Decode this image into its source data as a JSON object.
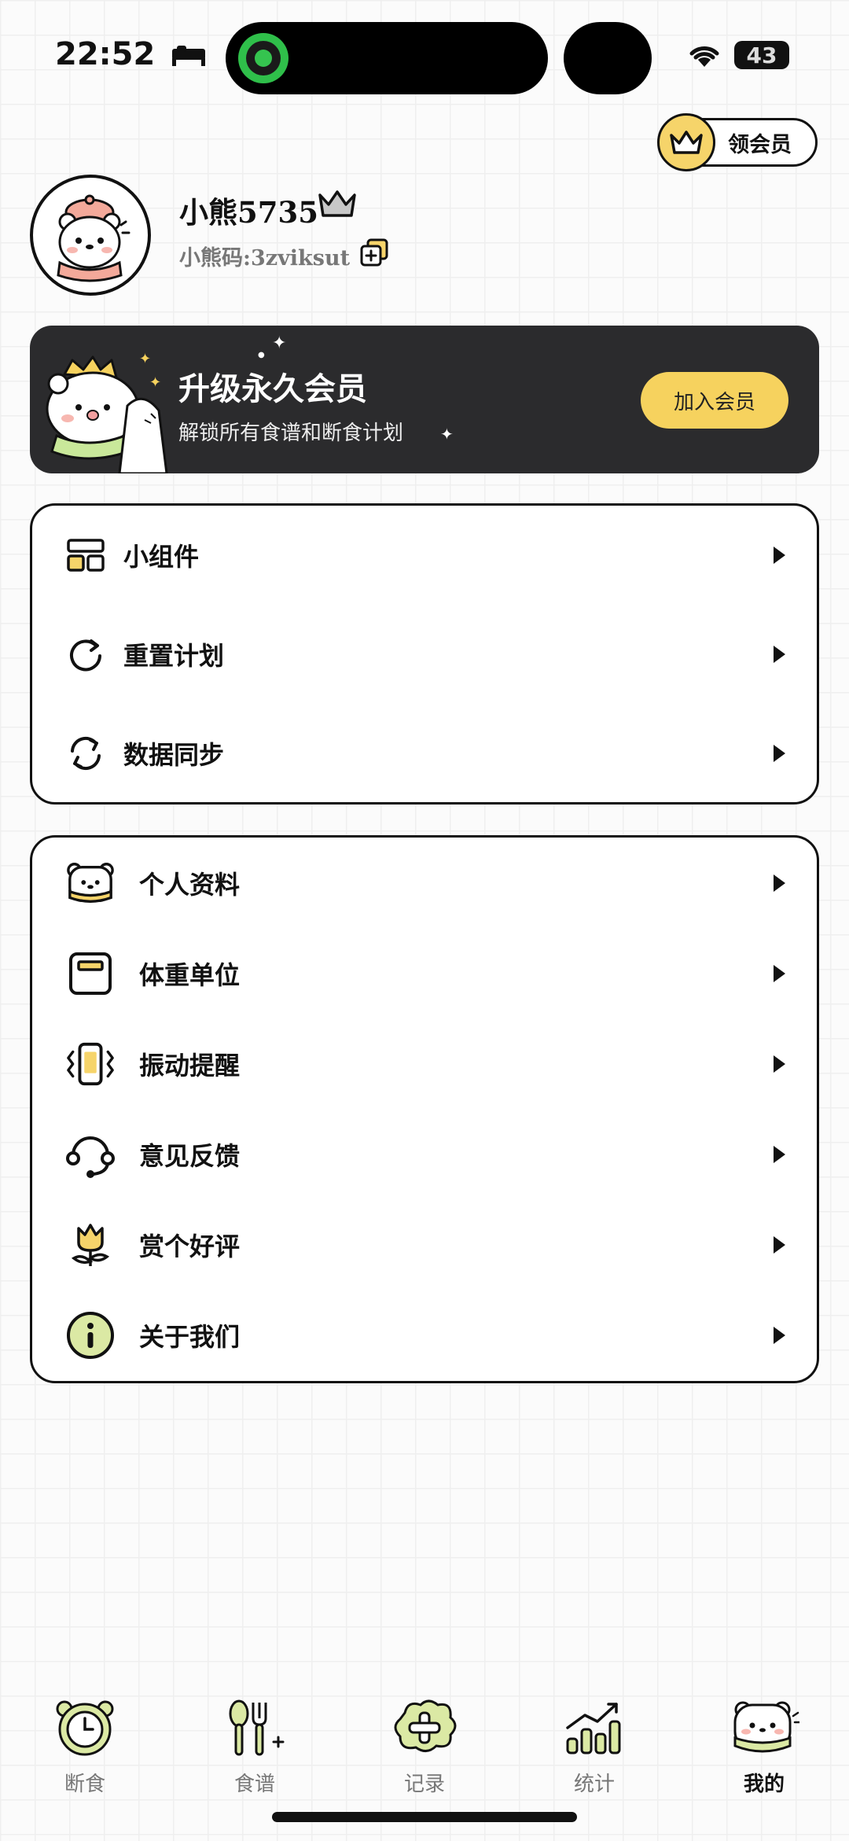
{
  "status_bar": {
    "time": "22:52",
    "battery": "43"
  },
  "vip_button": {
    "label": "领会员"
  },
  "profile": {
    "name": "小熊5735",
    "code": "小熊码:3zviksut"
  },
  "banner": {
    "title": "升级永久会员",
    "subtitle": "解锁所有食谱和断食计划",
    "button": "加入会员"
  },
  "menu_group_1": [
    {
      "label": "小组件",
      "icon": "widget-icon"
    },
    {
      "label": "重置计划",
      "icon": "reset-icon"
    },
    {
      "label": "数据同步",
      "icon": "sync-icon"
    }
  ],
  "menu_group_2": [
    {
      "label": "个人资料",
      "icon": "bear-profile-icon"
    },
    {
      "label": "体重单位",
      "icon": "scale-icon"
    },
    {
      "label": "振动提醒",
      "icon": "vibration-icon"
    },
    {
      "label": "意见反馈",
      "icon": "headset-icon"
    },
    {
      "label": "赏个好评",
      "icon": "flower-icon"
    },
    {
      "label": "关于我们",
      "icon": "info-icon"
    }
  ],
  "tabs": [
    {
      "label": "断食",
      "icon": "clock-icon"
    },
    {
      "label": "食谱",
      "icon": "utensils-icon"
    },
    {
      "label": "记录",
      "icon": "add-record-icon"
    },
    {
      "label": "统计",
      "icon": "stats-icon"
    },
    {
      "label": "我的",
      "icon": "bear-icon"
    }
  ],
  "colors": {
    "accent": "#f6d25e",
    "banner_bg": "#2b2b2d",
    "lime": "#dbe9a4",
    "yellow": "#f6d46a"
  }
}
